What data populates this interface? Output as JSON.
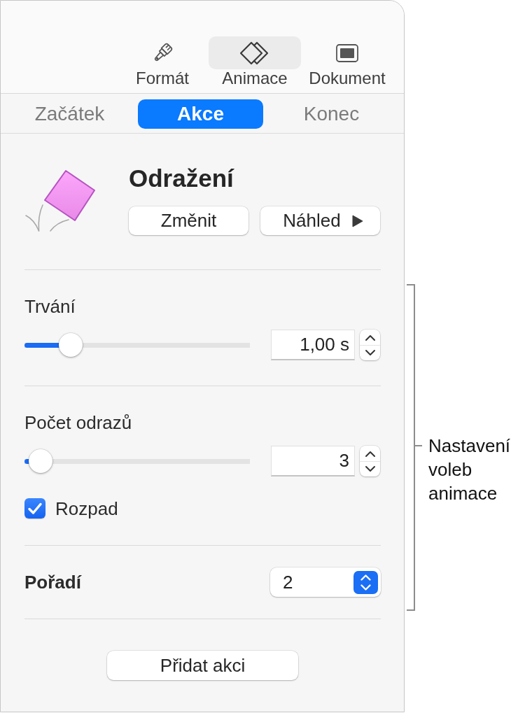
{
  "toolbar": {
    "items": [
      {
        "label": "Formát",
        "selected": false
      },
      {
        "label": "Animace",
        "selected": true
      },
      {
        "label": "Dokument",
        "selected": false
      }
    ]
  },
  "tabs": [
    {
      "label": "Začátek",
      "selected": false
    },
    {
      "label": "Akce",
      "selected": true
    },
    {
      "label": "Konec",
      "selected": false
    }
  ],
  "effect": {
    "title": "Odražení",
    "change_button": "Změnit",
    "preview_button": "Náhled"
  },
  "sections": [
    {
      "controls": [
        {
          "kind": "slider",
          "label": "Trvání",
          "level": 0.17,
          "value": "1,00 s"
        }
      ]
    },
    {
      "controls": [
        {
          "kind": "slider",
          "label": "Počet odrazů",
          "level": 0.02,
          "value": "3"
        },
        {
          "kind": "checkbox",
          "label": "Rozpad",
          "checked": true
        }
      ]
    },
    {
      "controls": [
        {
          "kind": "popup",
          "label": "Pořadí",
          "value": "2"
        }
      ]
    }
  ],
  "add_action_button": "Přidat akci",
  "callout": {
    "label": "Nastavení voleb animace"
  }
}
